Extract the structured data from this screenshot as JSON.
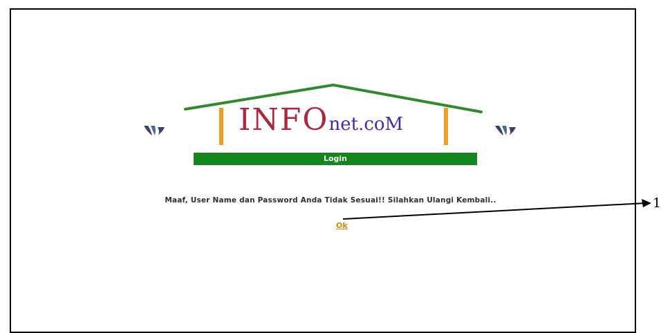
{
  "logo": {
    "main_text": "INFO",
    "sub_text": "net.coM"
  },
  "login_bar": {
    "label": "Login"
  },
  "message": {
    "text": "Maaf, User Name dan Password Anda Tidak Sesuai!! Silahkan Ulangi Kembali.."
  },
  "ok_link": {
    "label": "Ok"
  },
  "callout": {
    "number": "1"
  },
  "colors": {
    "roof": "#2e8b2a",
    "posts": "#f0a020",
    "brand_red": "#b0263c",
    "brand_blue": "#3d2fa8",
    "login_bar": "#13861c",
    "link": "#d98700"
  },
  "icons": [
    "bird-left-icon",
    "bird-right-icon"
  ]
}
